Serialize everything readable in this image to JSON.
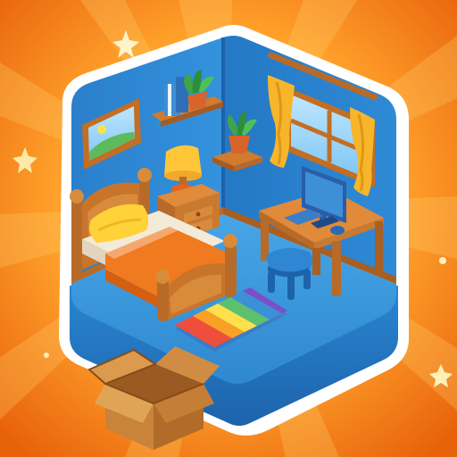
{
  "app_icon": {
    "theme": "cozy-isometric-bedroom",
    "icons": [
      "sparkle-star-icon",
      "cardboard-box-icon",
      "potted-plant-icon",
      "desk-lamp-icon",
      "computer-monitor-icon"
    ],
    "colors": {
      "background_center": "#FFB33A",
      "background_edge": "#EC6A0E",
      "room_outline": "#FFFFFF",
      "wall": "#2D88D3",
      "wall_shadow": "#1D6AB0",
      "floor": "#3E9BDD",
      "wood": "#C8742B",
      "bedspread": "#F07A1F",
      "pillow": "#FFD23A",
      "curtain": "#F7B62A",
      "rug_stripes": [
        "#F04E3A",
        "#F9A126",
        "#FFE04A",
        "#5CC16D",
        "#3D8FD6",
        "#7A4FC8"
      ],
      "box": "#C9833A"
    }
  }
}
